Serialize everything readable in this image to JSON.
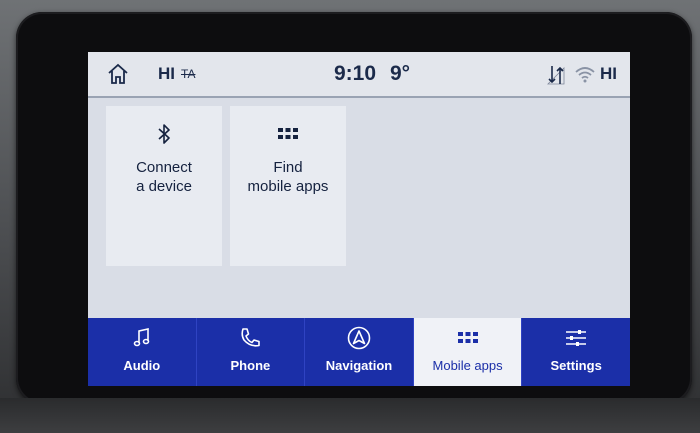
{
  "status_bar": {
    "climate_left": "HI",
    "ta_label": "TA",
    "time": "9:10",
    "temperature": "9°",
    "climate_right": "HI"
  },
  "tiles": [
    {
      "label": "Connect\na device",
      "icon": "bluetooth-icon"
    },
    {
      "label": "Find\nmobile apps",
      "icon": "apps-grid-icon"
    }
  ],
  "nav": {
    "items": [
      {
        "label": "Audio",
        "icon": "music-note-icon"
      },
      {
        "label": "Phone",
        "icon": "phone-icon"
      },
      {
        "label": "Navigation",
        "icon": "navigation-arrow-icon"
      },
      {
        "label": "Mobile apps",
        "icon": "apps-grid-icon"
      },
      {
        "label": "Settings",
        "icon": "settings-sliders-icon"
      }
    ],
    "active": "Mobile apps"
  },
  "colors": {
    "nav_bg": "#1b2fa8",
    "screen_bg": "#d9dde6",
    "text_dark": "#15223f"
  }
}
